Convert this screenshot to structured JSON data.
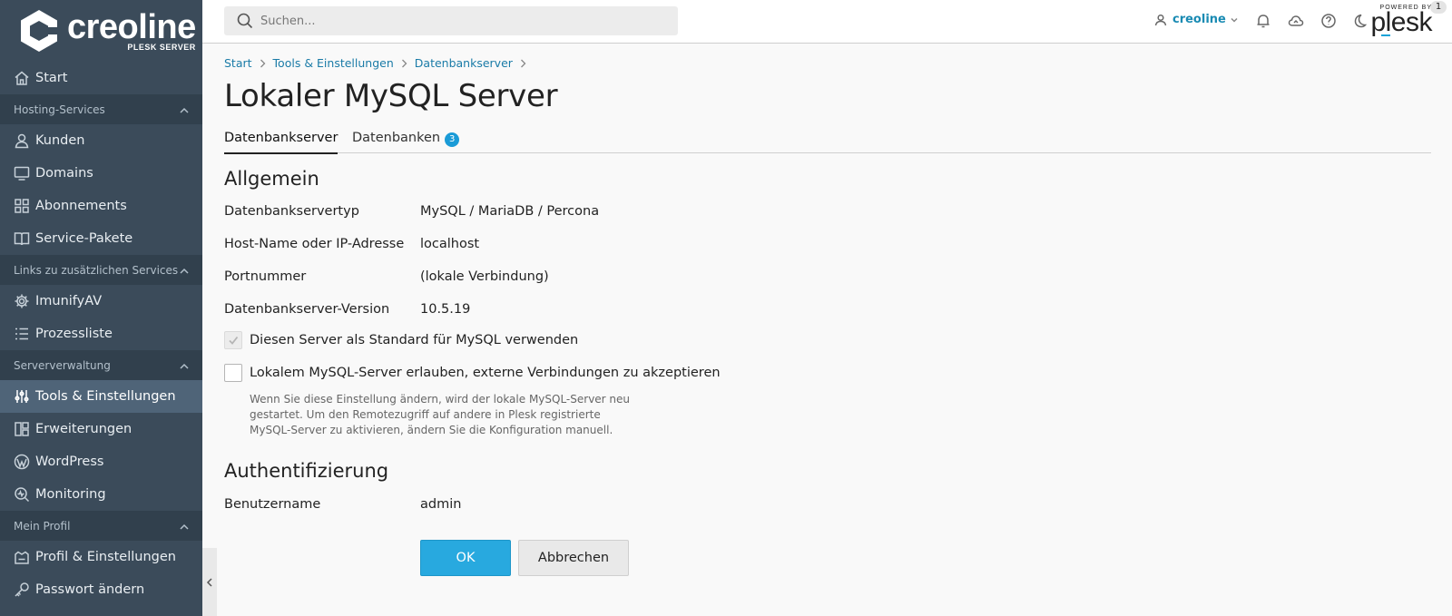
{
  "brand": {
    "name": "creoline",
    "subtitle": "PLESK SERVER"
  },
  "search": {
    "placeholder": "Suchen..."
  },
  "header": {
    "user": "creoline",
    "notifications_count": "1",
    "powered_by": "POWERED BY",
    "product": "plesk"
  },
  "sidebar": {
    "start": "Start",
    "groups": [
      {
        "label": "Hosting-Services",
        "items": [
          "Kunden",
          "Domains",
          "Abonnements",
          "Service-Pakete"
        ]
      },
      {
        "label": "Links zu zusätzlichen Services",
        "items": [
          "ImunifyAV",
          "Prozessliste"
        ]
      },
      {
        "label": "Serververwaltung",
        "items": [
          "Tools & Einstellungen",
          "Erweiterungen",
          "WordPress",
          "Monitoring"
        ]
      },
      {
        "label": "Mein Profil",
        "items": [
          "Profil & Einstellungen",
          "Passwort ändern"
        ]
      }
    ]
  },
  "breadcrumb": [
    "Start",
    "Tools & Einstellungen",
    "Datenbankserver"
  ],
  "page": {
    "title": "Lokaler MySQL Server",
    "tabs": [
      {
        "label": "Datenbankserver",
        "active": true
      },
      {
        "label": "Datenbanken",
        "badge": "3"
      }
    ]
  },
  "general": {
    "title": "Allgemein",
    "rows": [
      {
        "label": "Datenbankservertyp",
        "value": "MySQL / MariaDB / Percona"
      },
      {
        "label": "Host-Name oder IP-Adresse",
        "value": "localhost"
      },
      {
        "label": "Portnummer",
        "value": "(lokale Verbindung)"
      },
      {
        "label": "Datenbankserver-Version",
        "value": "10.5.19"
      }
    ],
    "checkbox_default": {
      "label": "Diesen Server als Standard für MySQL verwenden",
      "checked": true,
      "disabled": true
    },
    "checkbox_remote": {
      "label": "Lokalem MySQL-Server erlauben, externe Verbindungen zu akzeptieren",
      "checked": false,
      "hint": "Wenn Sie diese Einstellung ändern, wird der lokale MySQL-Server neu gestartet. Um den Remotezugriff auf andere in Plesk registrierte MySQL-Server zu aktivieren, ändern Sie die Konfiguration manuell."
    }
  },
  "auth": {
    "title": "Authentifizierung",
    "rows": [
      {
        "label": "Benutzername",
        "value": "admin"
      }
    ]
  },
  "buttons": {
    "ok": "OK",
    "cancel": "Abbrechen"
  },
  "colors": {
    "sidebar": "#3b4b5a",
    "sidebar_group": "#31404d",
    "sidebar_active": "#4f6478",
    "accent": "#28a9df",
    "link": "#1a7ba7"
  }
}
